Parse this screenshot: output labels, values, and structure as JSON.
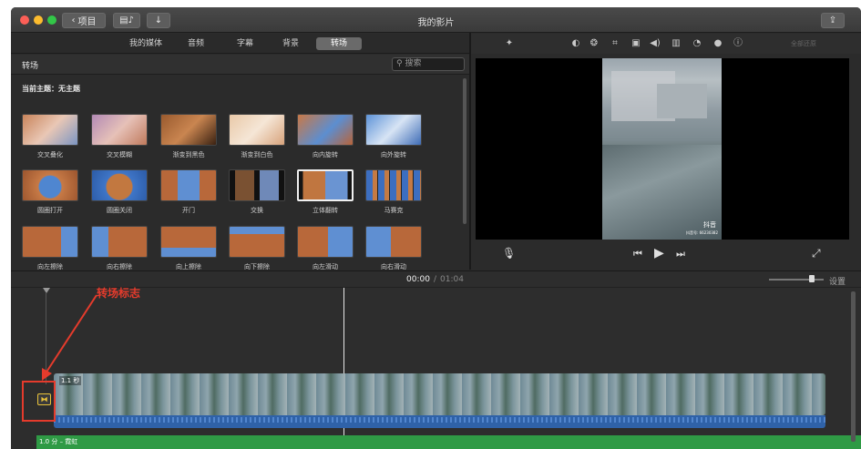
{
  "window": {
    "title": "我的影片"
  },
  "toolbar": {
    "back_label": "项目"
  },
  "tabs": [
    {
      "label": "我的媒体",
      "active": false
    },
    {
      "label": "音频",
      "active": false
    },
    {
      "label": "字幕",
      "active": false
    },
    {
      "label": "背景",
      "active": false
    },
    {
      "label": "转场",
      "active": true
    }
  ],
  "browser": {
    "section_title": "转场",
    "search_placeholder": "搜索",
    "theme_label": "当前主题：无主题",
    "transitions": [
      "交叉叠化",
      "交叉模糊",
      "渐变到黑色",
      "渐变到白色",
      "向内旋转",
      "向外旋转",
      "圆圈打开",
      "圆圈关闭",
      "开门",
      "交换",
      "立体翻转",
      "马赛克",
      "向左擦除",
      "向右擦除",
      "向上擦除",
      "向下擦除",
      "向左滑动",
      "向右滑动"
    ],
    "selected_transition": "立体翻转"
  },
  "viewer": {
    "reset_label": "全部还原",
    "watermark": "抖音",
    "watermark_id": "抖音号: 66230382"
  },
  "timeline": {
    "current_time": "00:00",
    "total_time": "01:04",
    "settings_label": "设置",
    "clip_label": "1.1 秒",
    "music_label": "1.0 分 – 霓虹",
    "annotation": "转场标志"
  },
  "colors": {
    "accent_red": "#e53b2c",
    "audio_blue": "#2f62a8",
    "music_green": "#2f9a45",
    "transition_yellow": "#e8c13a"
  }
}
